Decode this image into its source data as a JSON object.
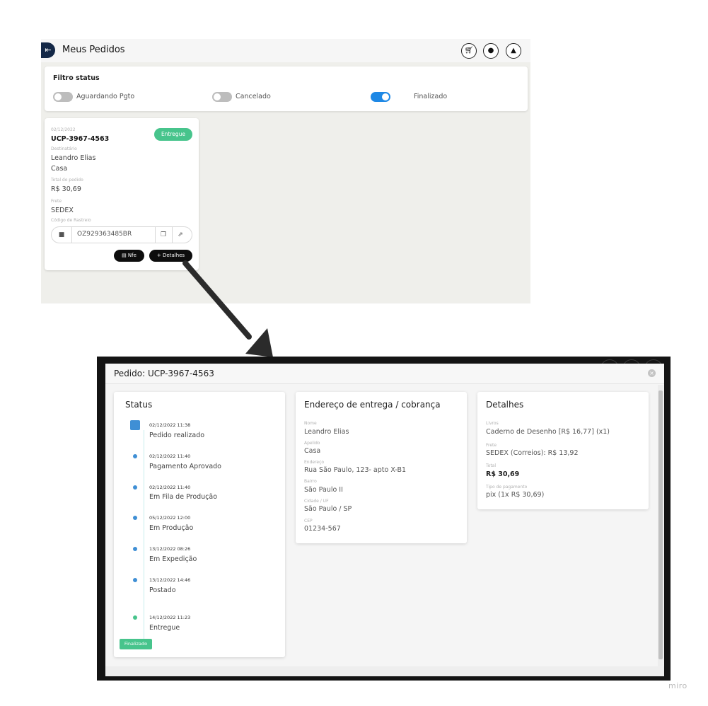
{
  "orders_screen": {
    "title": "Meus Pedidos",
    "back_icon": "arrow-collapse-left",
    "header_icons": [
      "cart-icon",
      "user-icon",
      "bell-icon"
    ],
    "filter": {
      "title": "Filtro status",
      "toggles": [
        {
          "label": "Aguardando Pgto",
          "on": false
        },
        {
          "label": "Cancelado",
          "on": false
        },
        {
          "label": "Finalizado",
          "on": true
        }
      ]
    },
    "order_card": {
      "date": "02/12/2022",
      "code": "UCP-3967-4563",
      "status_badge": "Entregue",
      "recipient_label": "Destinatário",
      "recipient_name": "Leandro Elias",
      "recipient_nickname": "Casa",
      "total_label": "Total do pedido",
      "total_value": "R$ 30,69",
      "shipping_label": "Frete",
      "shipping_value": "SEDEX",
      "tracking_label": "Código de Rastreio",
      "tracking_code": "OZ929363485BR",
      "nfe_button": "Nfe",
      "details_button": "Detalhes"
    }
  },
  "modal": {
    "title": "Pedido: UCP-3967-4563",
    "status_panel": {
      "title": "Status",
      "events": [
        {
          "datetime": "02/12/2022 11:38",
          "label": "Pedido realizado"
        },
        {
          "datetime": "02/12/2022 11:40",
          "label": "Pagamento Aprovado"
        },
        {
          "datetime": "02/12/2022 11:40",
          "label": "Em Fila de Produção"
        },
        {
          "datetime": "05/12/2022 12:00",
          "label": "Em Produção"
        },
        {
          "datetime": "13/12/2022 08:26",
          "label": "Em Expedição"
        },
        {
          "datetime": "13/12/2022 14:46",
          "label": "Postado"
        },
        {
          "datetime": "14/12/2022 11:23",
          "label": "Entregue"
        }
      ],
      "final_badge": "Finalizado"
    },
    "address_panel": {
      "title": "Endereço de entrega / cobrança",
      "fields": [
        {
          "label": "Nome",
          "value": "Leandro Elias"
        },
        {
          "label": "Apelido",
          "value": "Casa"
        },
        {
          "label": "Endereço",
          "value": "Rua São Paulo, 123- apto X-B1"
        },
        {
          "label": "Bairro",
          "value": "São Paulo II"
        },
        {
          "label": "Cidade / UF",
          "value": "São Paulo / SP"
        },
        {
          "label": "CEP",
          "value": "01234-567"
        }
      ]
    },
    "details_panel": {
      "title": "Detalhes",
      "fields": [
        {
          "label": "Livros",
          "value": "Caderno de Desenho [R$ 16,77] (x1)"
        },
        {
          "label": "Frete",
          "value": "SEDEX (Correios): R$ 13,92"
        },
        {
          "label": "Total",
          "value": "R$ 30,69"
        },
        {
          "label": "Tipo de pagamento",
          "value": "pix (1x R$ 30,69)"
        }
      ]
    }
  },
  "watermark": "miro",
  "colors": {
    "brand_navy": "#142847",
    "toggle_on": "#1e88e5",
    "success_green": "#47c48c",
    "timeline_blue": "#3f8fd5"
  }
}
